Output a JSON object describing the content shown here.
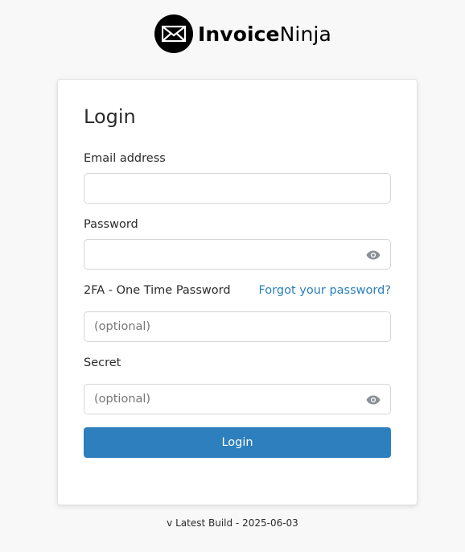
{
  "brand": {
    "name_part1": "Invoice",
    "name_part2": "Ninja",
    "icon": "envelope-logo-icon"
  },
  "login_card": {
    "title": "Login",
    "email": {
      "label": "Email address",
      "value": "",
      "placeholder": ""
    },
    "password": {
      "label": "Password",
      "value": "",
      "placeholder": "",
      "toggle_icon": "eye-icon"
    },
    "two_factor": {
      "label": "2FA - One Time Password",
      "value": "",
      "placeholder": "(optional)"
    },
    "forgot_password_link": "Forgot your password?",
    "secret": {
      "label": "Secret",
      "value": "",
      "placeholder": "(optional)",
      "toggle_icon": "eye-icon"
    },
    "submit_label": "Login"
  },
  "footer": {
    "version_text": "v Latest Build - 2025-06-03"
  },
  "colors": {
    "page_background": "#f8f8f8",
    "primary_button": "#2d7fbd",
    "link": "#2a7ebc",
    "text": "#2b2b2b"
  }
}
